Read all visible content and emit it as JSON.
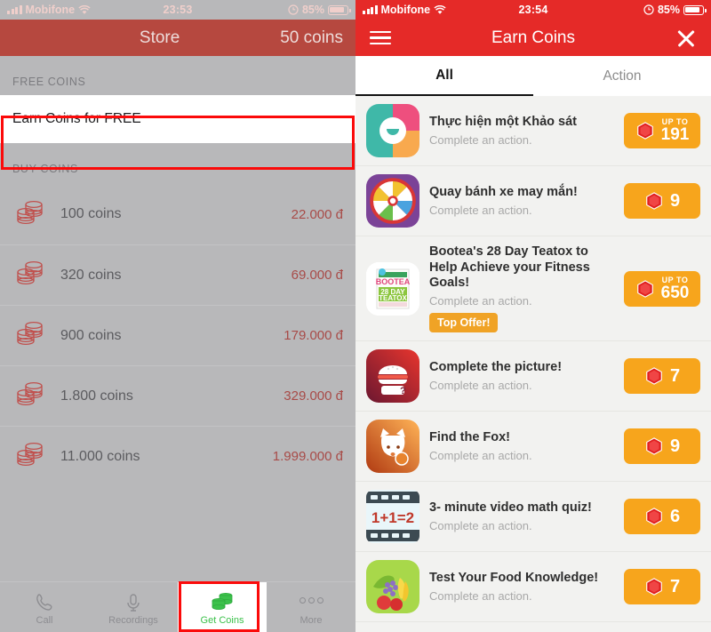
{
  "left": {
    "status": {
      "carrier": "Mobifone",
      "time": "23:53",
      "battery": "85%",
      "wifi_icon": "wifi-icon",
      "lock_icon": "orientation-lock-icon"
    },
    "header": {
      "title": "Store",
      "coins": "50 coins"
    },
    "free_section_label": "FREE COINS",
    "free_row_label": "Earn Coins for FREE",
    "buy_section_label": "BUY COINS",
    "buy_items": [
      {
        "name": "100 coins",
        "price": "22.000 đ"
      },
      {
        "name": "320 coins",
        "price": "69.000 đ"
      },
      {
        "name": "900 coins",
        "price": "179.000 đ"
      },
      {
        "name": "1.800 coins",
        "price": "329.000 đ"
      },
      {
        "name": "11.000 coins",
        "price": "1.999.000 đ"
      }
    ],
    "tabs": [
      {
        "label": "Call",
        "icon": "phone-icon",
        "active": false
      },
      {
        "label": "Recordings",
        "icon": "microphone-icon",
        "active": false
      },
      {
        "label": "Get Coins",
        "icon": "coins-icon",
        "active": true
      },
      {
        "label": "More",
        "icon": "ellipsis-icon",
        "active": false
      }
    ],
    "annotation_color": "#fb0a0a"
  },
  "right": {
    "status": {
      "carrier": "Mobifone",
      "time": "23:54",
      "battery": "85%"
    },
    "header": {
      "title": "Earn Coins",
      "menu_icon": "hamburger-menu-icon",
      "close_icon": "close-icon"
    },
    "tabs": [
      {
        "label": "All",
        "selected": true
      },
      {
        "label": "Action",
        "selected": false
      }
    ],
    "offers": [
      {
        "title": "Thực hiện một Khảo sát",
        "subtitle": "Complete an action.",
        "icon": "survey-icon",
        "reward": "191",
        "up_to": "UP TO",
        "badge": null
      },
      {
        "title": "Quay bánh xe may mắn!",
        "subtitle": "Complete an action.",
        "icon": "prize-wheel-icon",
        "reward": "9",
        "up_to": null,
        "badge": null
      },
      {
        "title": "Bootea's 28 Day Teatox to Help Achieve your Fitness Goals!",
        "subtitle": "Complete an action.",
        "icon": "bootea-box-icon",
        "reward": "650",
        "up_to": "UP TO",
        "badge": "Top Offer!"
      },
      {
        "title": "Complete the picture!",
        "subtitle": "Complete an action.",
        "icon": "burger-icon",
        "reward": "7",
        "up_to": null,
        "badge": null
      },
      {
        "title": "Find the Fox!",
        "subtitle": "Complete an action.",
        "icon": "fox-icon",
        "reward": "9",
        "up_to": null,
        "badge": null
      },
      {
        "title": "3- minute video math quiz!",
        "subtitle": "Complete an action.",
        "icon": "film-math-icon",
        "reward": "6",
        "up_to": null,
        "badge": null
      },
      {
        "title": "Test Your Food Knowledge!",
        "subtitle": "Complete an action.",
        "icon": "fruit-basket-icon",
        "reward": "7",
        "up_to": null,
        "badge": null
      }
    ],
    "accent_color": "#e52a28",
    "reward_color": "#f7a51c"
  }
}
